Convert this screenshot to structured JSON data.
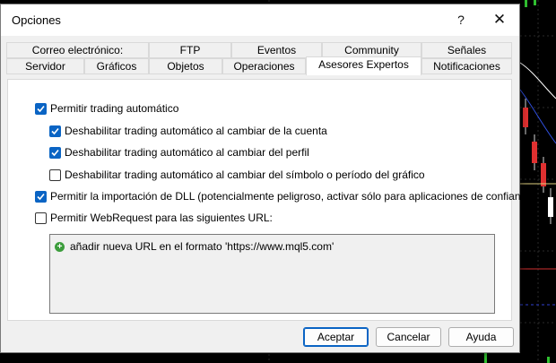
{
  "window": {
    "title": "Opciones",
    "help_symbol": "?",
    "close_symbol": "✕"
  },
  "tabs_row1": [
    {
      "label": "Correo electrónico:"
    },
    {
      "label": "FTP"
    },
    {
      "label": "Eventos"
    },
    {
      "label": "Community"
    },
    {
      "label": "Señales"
    }
  ],
  "tabs_row2": [
    {
      "label": "Servidor"
    },
    {
      "label": "Gráficos"
    },
    {
      "label": "Objetos"
    },
    {
      "label": "Operaciones"
    },
    {
      "label": "Asesores Expertos"
    },
    {
      "label": "Notificaciones"
    }
  ],
  "active_tab": "Asesores Expertos",
  "options": [
    {
      "label": "Permitir trading automático",
      "checked": true
    },
    {
      "label": "Deshabilitar trading automático al cambiar de la cuenta",
      "checked": true
    },
    {
      "label": "Deshabilitar trading automático al cambiar del perfil",
      "checked": true
    },
    {
      "label": "Deshabilitar trading automático al cambiar del símbolo o período del gráfico",
      "checked": false
    },
    {
      "label": "Permitir la importación de DLL (potencialmente peligroso, activar sólo para aplicaciones de confianza)",
      "checked": true
    },
    {
      "label": "Permitir WebRequest para las siguientes URL:",
      "checked": false
    }
  ],
  "url_list": {
    "add_label": "añadir nueva URL en el formato 'https://www.mql5.com'"
  },
  "buttons": {
    "ok": "Aceptar",
    "cancel": "Cancelar",
    "help": "Ayuda"
  },
  "colors": {
    "accent": "#0a64c4",
    "dialog_bg": "#f0f0f0",
    "panel_bg": "#ffffff",
    "chart_bg": "#000000"
  }
}
